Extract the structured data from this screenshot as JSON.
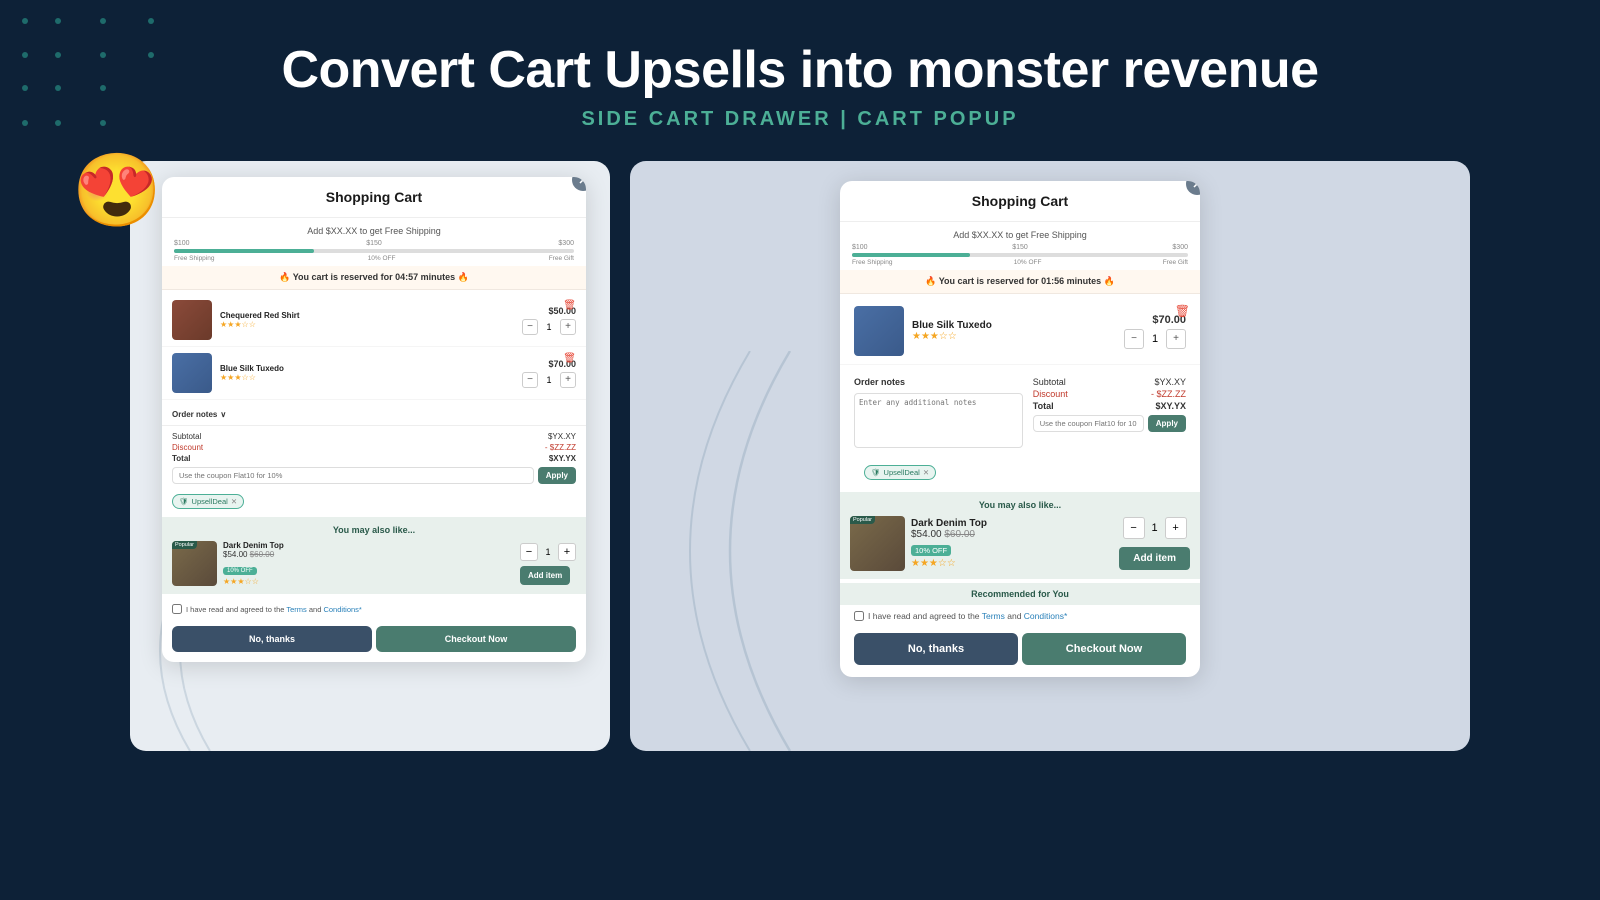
{
  "header": {
    "title": "Convert Cart Upsells into monster revenue",
    "subtitle": "SIDE CART DRAWER | CART POPUP"
  },
  "left_panel": {
    "cart_title": "Shopping Cart",
    "shipping_text": "Add $XX.XX to get Free Shipping",
    "milestones": [
      "$100",
      "$150",
      "$300"
    ],
    "milestone_labels": [
      "Free Shipping",
      "10% OFF",
      "Free Gift"
    ],
    "timer": "🔥 You cart is reserved for 04:57 minutes 🔥",
    "items": [
      {
        "name": "Chequered Red Shirt",
        "price": "$50.00",
        "stars": "★★★☆☆",
        "qty": "1",
        "color": "red"
      },
      {
        "name": "Blue Silk Tuxedo",
        "price": "$70.00",
        "stars": "★★★☆☆",
        "qty": "1",
        "color": "blue"
      }
    ],
    "order_notes_label": "Order notes",
    "order_notes_placeholder": "",
    "pricing": {
      "subtotal_label": "Subtotal",
      "subtotal_val": "$YX.XY",
      "discount_label": "Discount",
      "discount_val": "- $ZZ.ZZ",
      "total_label": "Total",
      "total_val": "$XY.YX"
    },
    "coupon_placeholder": "Use the coupon Flat10 for 10%",
    "coupon_apply": "Apply",
    "upsell_tag": "UpsellDeal",
    "upsell_section_title": "You may also like...",
    "upsell_item": {
      "name": "Dark Denim Top",
      "price": "$54.00",
      "orig_price": "$60.00",
      "discount_badge": "10% OFF",
      "stars": "★★★☆☆",
      "qty": "1"
    },
    "add_item_label": "Add item",
    "terms_text": "I have read and agreed to the",
    "terms_link": "Terms",
    "terms_and": "and",
    "conditions_link": "Conditions*",
    "btn_no_thanks": "No, thanks",
    "btn_checkout": "Checkout Now"
  },
  "right_panel": {
    "cart_title": "Shopping Cart",
    "shipping_text": "Add $XX.XX to get Free Shipping",
    "milestones": [
      "$100",
      "$150",
      "$300"
    ],
    "milestone_labels": [
      "Free Shipping",
      "10% OFF",
      "Free Gift"
    ],
    "timer": "🔥 You cart is reserved for 01:56 minutes 🔥",
    "items": [
      {
        "name": "Blue Silk Tuxedo",
        "price": "$70.00",
        "stars": "★★★☆☆",
        "qty": "1",
        "color": "blue"
      }
    ],
    "order_notes_label": "Order notes",
    "order_notes_placeholder": "Enter any additional notes",
    "pricing": {
      "subtotal_label": "Subtotal",
      "subtotal_val": "$YX.XY",
      "discount_label": "Discount",
      "discount_val": "- $ZZ.ZZ",
      "total_label": "Total",
      "total_val": "$XY.YX"
    },
    "coupon_placeholder": "Use the coupon Flat10 for 10",
    "coupon_apply": "Apply",
    "upsell_tag": "UpsellDeal",
    "upsell_section_title": "You may also like...",
    "upsell_item": {
      "name": "Dark Denim Top",
      "price": "$54.00",
      "orig_price": "$60.00",
      "discount_badge": "10% OFF",
      "stars": "★★★☆☆",
      "qty": "1"
    },
    "add_item_label": "Add item",
    "recommended_title": "Recommended for You",
    "terms_text": "I have read and agreed to the",
    "terms_link": "Terms",
    "terms_and": "and",
    "conditions_link": "Conditions*",
    "btn_no_thanks": "No, thanks",
    "btn_checkout": "Checkout Now"
  },
  "icons": {
    "close": "✕",
    "delete": "🗑",
    "fire": "🔥",
    "shield": "🛡",
    "chevron": "∨",
    "minus": "−",
    "plus": "+"
  }
}
